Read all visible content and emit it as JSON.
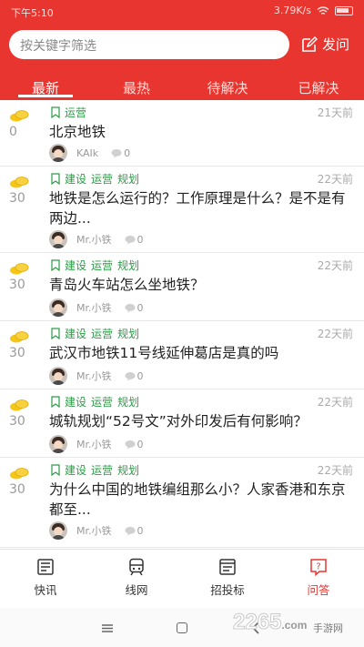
{
  "status_bar": {
    "time": "下午5:10",
    "speed": "3.79K/s"
  },
  "search": {
    "placeholder": "按关键字筛选"
  },
  "ask_button": {
    "label": "发问"
  },
  "tabs": [
    {
      "label": "最新",
      "active": true
    },
    {
      "label": "最热",
      "active": false
    },
    {
      "label": "待解决",
      "active": false
    },
    {
      "label": "已解决",
      "active": false
    }
  ],
  "questions": [
    {
      "score": "0",
      "tags": [
        "运营"
      ],
      "time": "21天前",
      "title": "北京地铁",
      "author": "KAIk",
      "comments": "0"
    },
    {
      "score": "30",
      "tags": [
        "建设",
        "运营",
        "规划"
      ],
      "time": "22天前",
      "title": "地铁是怎么运行的？工作原理是什么？是不是有两边...",
      "author": "Mr.小铁",
      "comments": "0"
    },
    {
      "score": "30",
      "tags": [
        "建设",
        "运营",
        "规划"
      ],
      "time": "22天前",
      "title": "青岛火车站怎么坐地铁？",
      "author": "Mr.小铁",
      "comments": "0"
    },
    {
      "score": "30",
      "tags": [
        "建设",
        "运营",
        "规划"
      ],
      "time": "22天前",
      "title": "武汉市地铁11号线延伸葛店是真的吗",
      "author": "Mr.小铁",
      "comments": "0"
    },
    {
      "score": "30",
      "tags": [
        "建设",
        "运营",
        "规划"
      ],
      "time": "22天前",
      "title": "城轨规划“52号文”对外印发后有何影响？",
      "author": "Mr.小铁",
      "comments": "0"
    },
    {
      "score": "30",
      "tags": [
        "建设",
        "运营",
        "规划"
      ],
      "time": "22天前",
      "title": "为什么中国的地铁编组那么小？人家香港和东京都至...",
      "author": "Mr.小铁",
      "comments": "0"
    }
  ],
  "bottom_nav": [
    {
      "label": "快讯",
      "icon": "news-icon",
      "active": false
    },
    {
      "label": "线网",
      "icon": "train-icon",
      "active": false
    },
    {
      "label": "招投标",
      "icon": "bidding-icon",
      "active": false
    },
    {
      "label": "问答",
      "icon": "qa-icon",
      "active": true
    }
  ],
  "watermark": {
    "brand": "2265",
    "suffix": ".com",
    "sub": "手游网"
  },
  "colors": {
    "brand_red": "#e8352f",
    "tag_green": "#2d9b47",
    "coin_yellow": "#f5c518"
  }
}
